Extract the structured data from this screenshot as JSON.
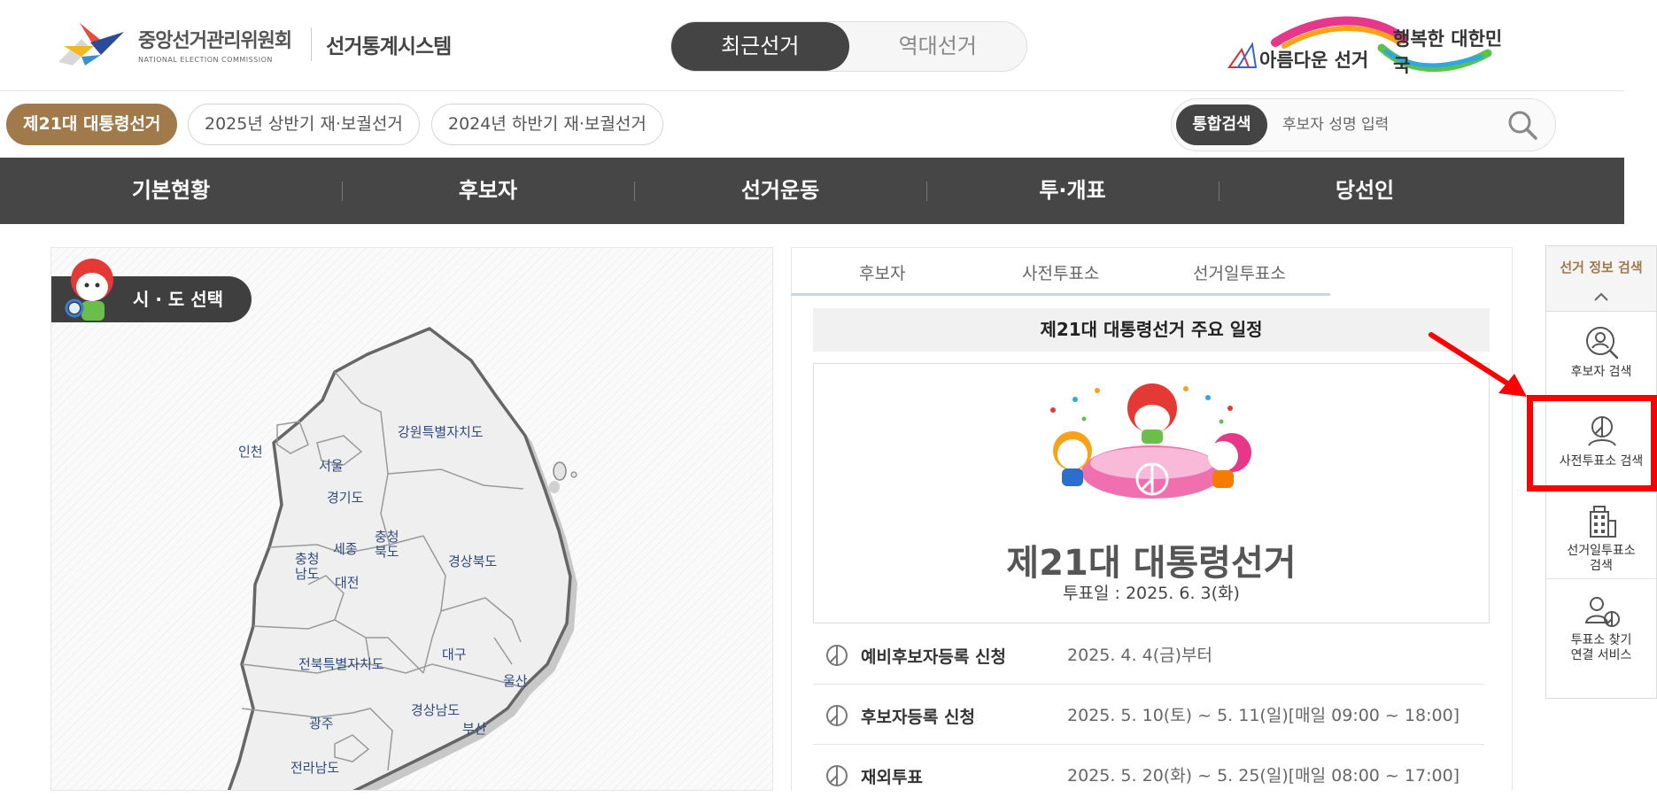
{
  "header": {
    "org_name": "중앙선거관리위원회",
    "org_name_en": "NATIONAL ELECTION COMMISSION",
    "system_name": "선거통계시스템",
    "toggle": [
      "최근선거",
      "역대선거"
    ],
    "slogan_left": "아름다운 선거",
    "slogan_right": "행복한 대한민국"
  },
  "election_tabs": [
    "제21대 대통령선거",
    "2025년 상반기 재·보궐선거",
    "2024년 하반기 재·보궐선거"
  ],
  "search": {
    "badge": "통합검색",
    "placeholder": "후보자 성명 입력"
  },
  "gnb": [
    "기본현황",
    "후보자",
    "선거운동",
    "투·개표",
    "당선인"
  ],
  "map": {
    "label": "시 · 도 선택",
    "regions": {
      "incheon": "인천",
      "seoul": "서울",
      "gangwon": "강원특별자치도",
      "gyeonggi": "경기도",
      "chungbuk": [
        "충청",
        "북도"
      ],
      "chungnam": [
        "충청",
        "남도"
      ],
      "sejong": "세종",
      "daejeon": "대전",
      "gyeongbuk": "경상북도",
      "daegu": "대구",
      "jeonbuk": "전북특별자치도",
      "ulsan": "울산",
      "gyeongnam": "경상남도",
      "gwangju": "광주",
      "busan": "부산",
      "jeonnam": "전라남도"
    }
  },
  "right_tabs": [
    "후보자",
    "사전투표소",
    "선거일투표소"
  ],
  "schedule": {
    "title": "제21대 대통령선거 주요 일정",
    "poster_title": "제21대 대통령선거",
    "poster_date": "투표일 : 2025. 6. 3(화)",
    "rows": [
      {
        "label": "예비후보자등록 신청",
        "value": "2025. 4. 4(금)부터"
      },
      {
        "label": "후보자등록 신청",
        "value": "2025. 5. 10(토) ~ 5. 11(일)[매일 09:00 ~ 18:00]"
      },
      {
        "label": "재외투표",
        "value": "2025. 5. 20(화) ~ 5. 25(일)[매일 08:00 ~ 17:00]"
      }
    ]
  },
  "quick_menu": {
    "title": "선거 정보 검색",
    "items": [
      {
        "label": "후보자 검색",
        "icon": "person-search-icon"
      },
      {
        "label": "사전투표소 검색",
        "icon": "vote-person-icon"
      },
      {
        "label": [
          "선거일투표소",
          "검색"
        ],
        "icon": "building-icon"
      },
      {
        "label": [
          "투표소 찾기",
          "연결 서비스"
        ],
        "icon": "person-vote-icon"
      }
    ]
  },
  "colors": {
    "accent_brown": "#a07a4a",
    "nav_dark": "#464646",
    "highlight": "#ff0000"
  }
}
